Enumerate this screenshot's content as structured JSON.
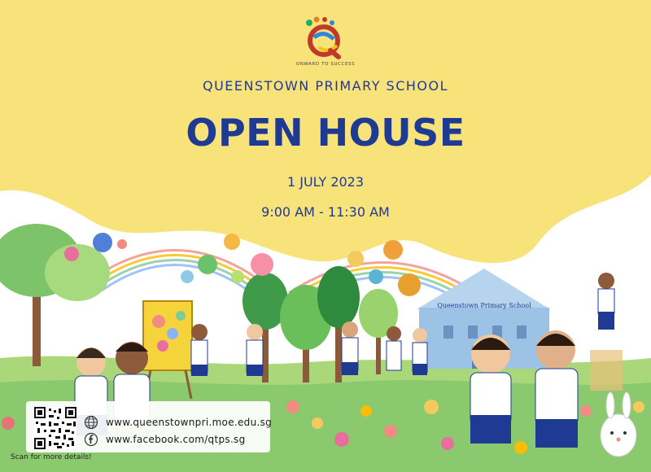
{
  "poster": {
    "school_name": "QUEENSTOWN PRIMARY SCHOOL",
    "event_title": "OPEN HOUSE",
    "event_date": "1 JULY 2023",
    "event_time": "9:00 AM - 11:30 AM"
  },
  "logo": {
    "motto": "ONWARD TO SUCCESS"
  },
  "illustration": {
    "building_sign": "Queenstown Primary School"
  },
  "links": {
    "website": "www.queenstownpri.moe.edu.sg",
    "facebook": "www.facebook.com/qtps.sg",
    "website_icon": "globe-icon",
    "facebook_icon": "facebook-icon",
    "scan_note": "Scan for more details!"
  },
  "colors": {
    "banner_yellow": "#f8e27a",
    "title_blue": "#1f3a93"
  }
}
